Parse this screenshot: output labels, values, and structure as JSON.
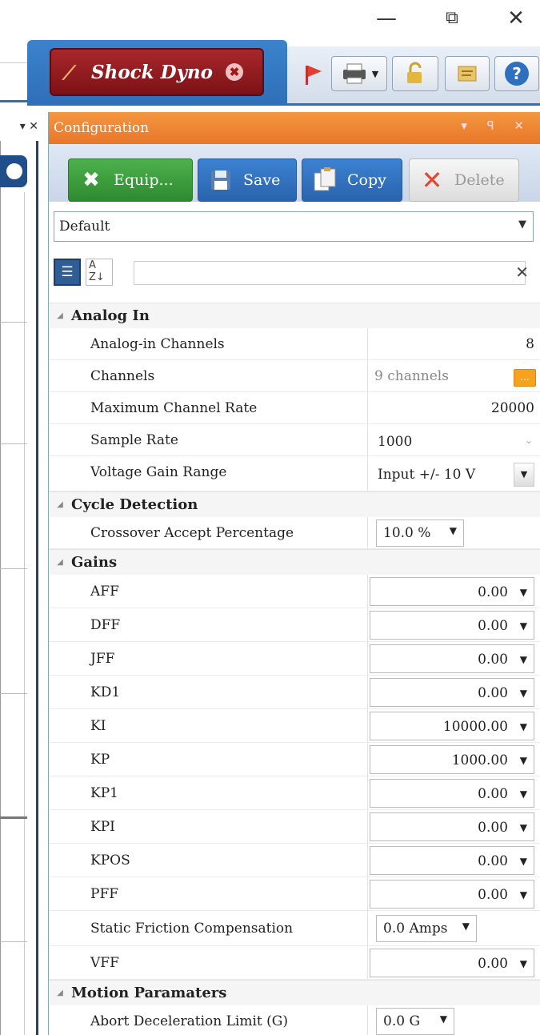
{
  "window": {
    "minimize_icon": "minimize-icon",
    "restore_icon": "restore-icon",
    "close_icon": "close-icon"
  },
  "tab": {
    "label": "Shock Dyno",
    "icon": "shock-absorber-icon",
    "close_icon": "shield-close-icon"
  },
  "toolbar": {
    "icons": [
      "flag-icon",
      "printer-icon",
      "lock-icon",
      "notes-icon",
      "help-icon"
    ],
    "help_glyph": "?"
  },
  "left_pane": {
    "header_controls": "▾ ✕"
  },
  "panel": {
    "title": "Configuration",
    "title_controls": "▾ ꟼ ✕",
    "actions": [
      {
        "label": "Equip...",
        "icon": "tools-icon"
      },
      {
        "label": "Save",
        "icon": "floppy-disk-icon"
      },
      {
        "label": "Copy",
        "icon": "copy-icon"
      },
      {
        "label": "Delete",
        "icon": "delete-x-icon"
      }
    ],
    "config_selected": "Default",
    "search": {
      "value": "",
      "placeholder": ""
    },
    "sort_glyph_top": "A",
    "sort_glyph_bottom": "Z↓"
  },
  "colors": {
    "panel_title": "#e8772a",
    "equip_button": "#3a9a3a",
    "save_button": "#2f6fc0",
    "copy_button": "#2f6fc0",
    "tab_red": "#8c171b",
    "ribbon_blue": "#2f6fb7",
    "ellipsis_orange": "#f6a21d"
  },
  "grid": {
    "analog_in": {
      "title": "Analog In",
      "analog_in_channels": {
        "label": "Analog-in Channels",
        "value": "8"
      },
      "channels": {
        "label": "Channels",
        "value": "9 channels",
        "button": "..."
      },
      "max_channel_rate": {
        "label": "Maximum Channel Rate",
        "value": "20000"
      },
      "sample_rate": {
        "label": "Sample Rate",
        "value": "1000"
      },
      "voltage_gain_range": {
        "label": "Voltage Gain Range",
        "value": "Input +/- 10 V"
      }
    },
    "cycle_detection": {
      "title": "Cycle Detection",
      "crossover": {
        "label": "Crossover Accept Percentage",
        "value": "10.0 %"
      }
    },
    "gains": {
      "title": "Gains",
      "rows": [
        {
          "label": "AFF",
          "value": "0.00"
        },
        {
          "label": "DFF",
          "value": "0.00"
        },
        {
          "label": "JFF",
          "value": "0.00"
        },
        {
          "label": "KD1",
          "value": "0.00"
        },
        {
          "label": "KI",
          "value": "10000.00"
        },
        {
          "label": "KP",
          "value": "1000.00"
        },
        {
          "label": "KP1",
          "value": "0.00"
        },
        {
          "label": "KPI",
          "value": "0.00"
        },
        {
          "label": "KPOS",
          "value": "0.00"
        },
        {
          "label": "PFF",
          "value": "0.00"
        }
      ],
      "static_friction": {
        "label": "Static Friction Compensation",
        "value": "0.0 Amps"
      },
      "vff": {
        "label": "VFF",
        "value": "0.00"
      }
    },
    "motion": {
      "title": "Motion Paramaters",
      "abort_decel": {
        "label": "Abort Deceleration Limit (G)",
        "value": "0.0 G"
      }
    }
  }
}
